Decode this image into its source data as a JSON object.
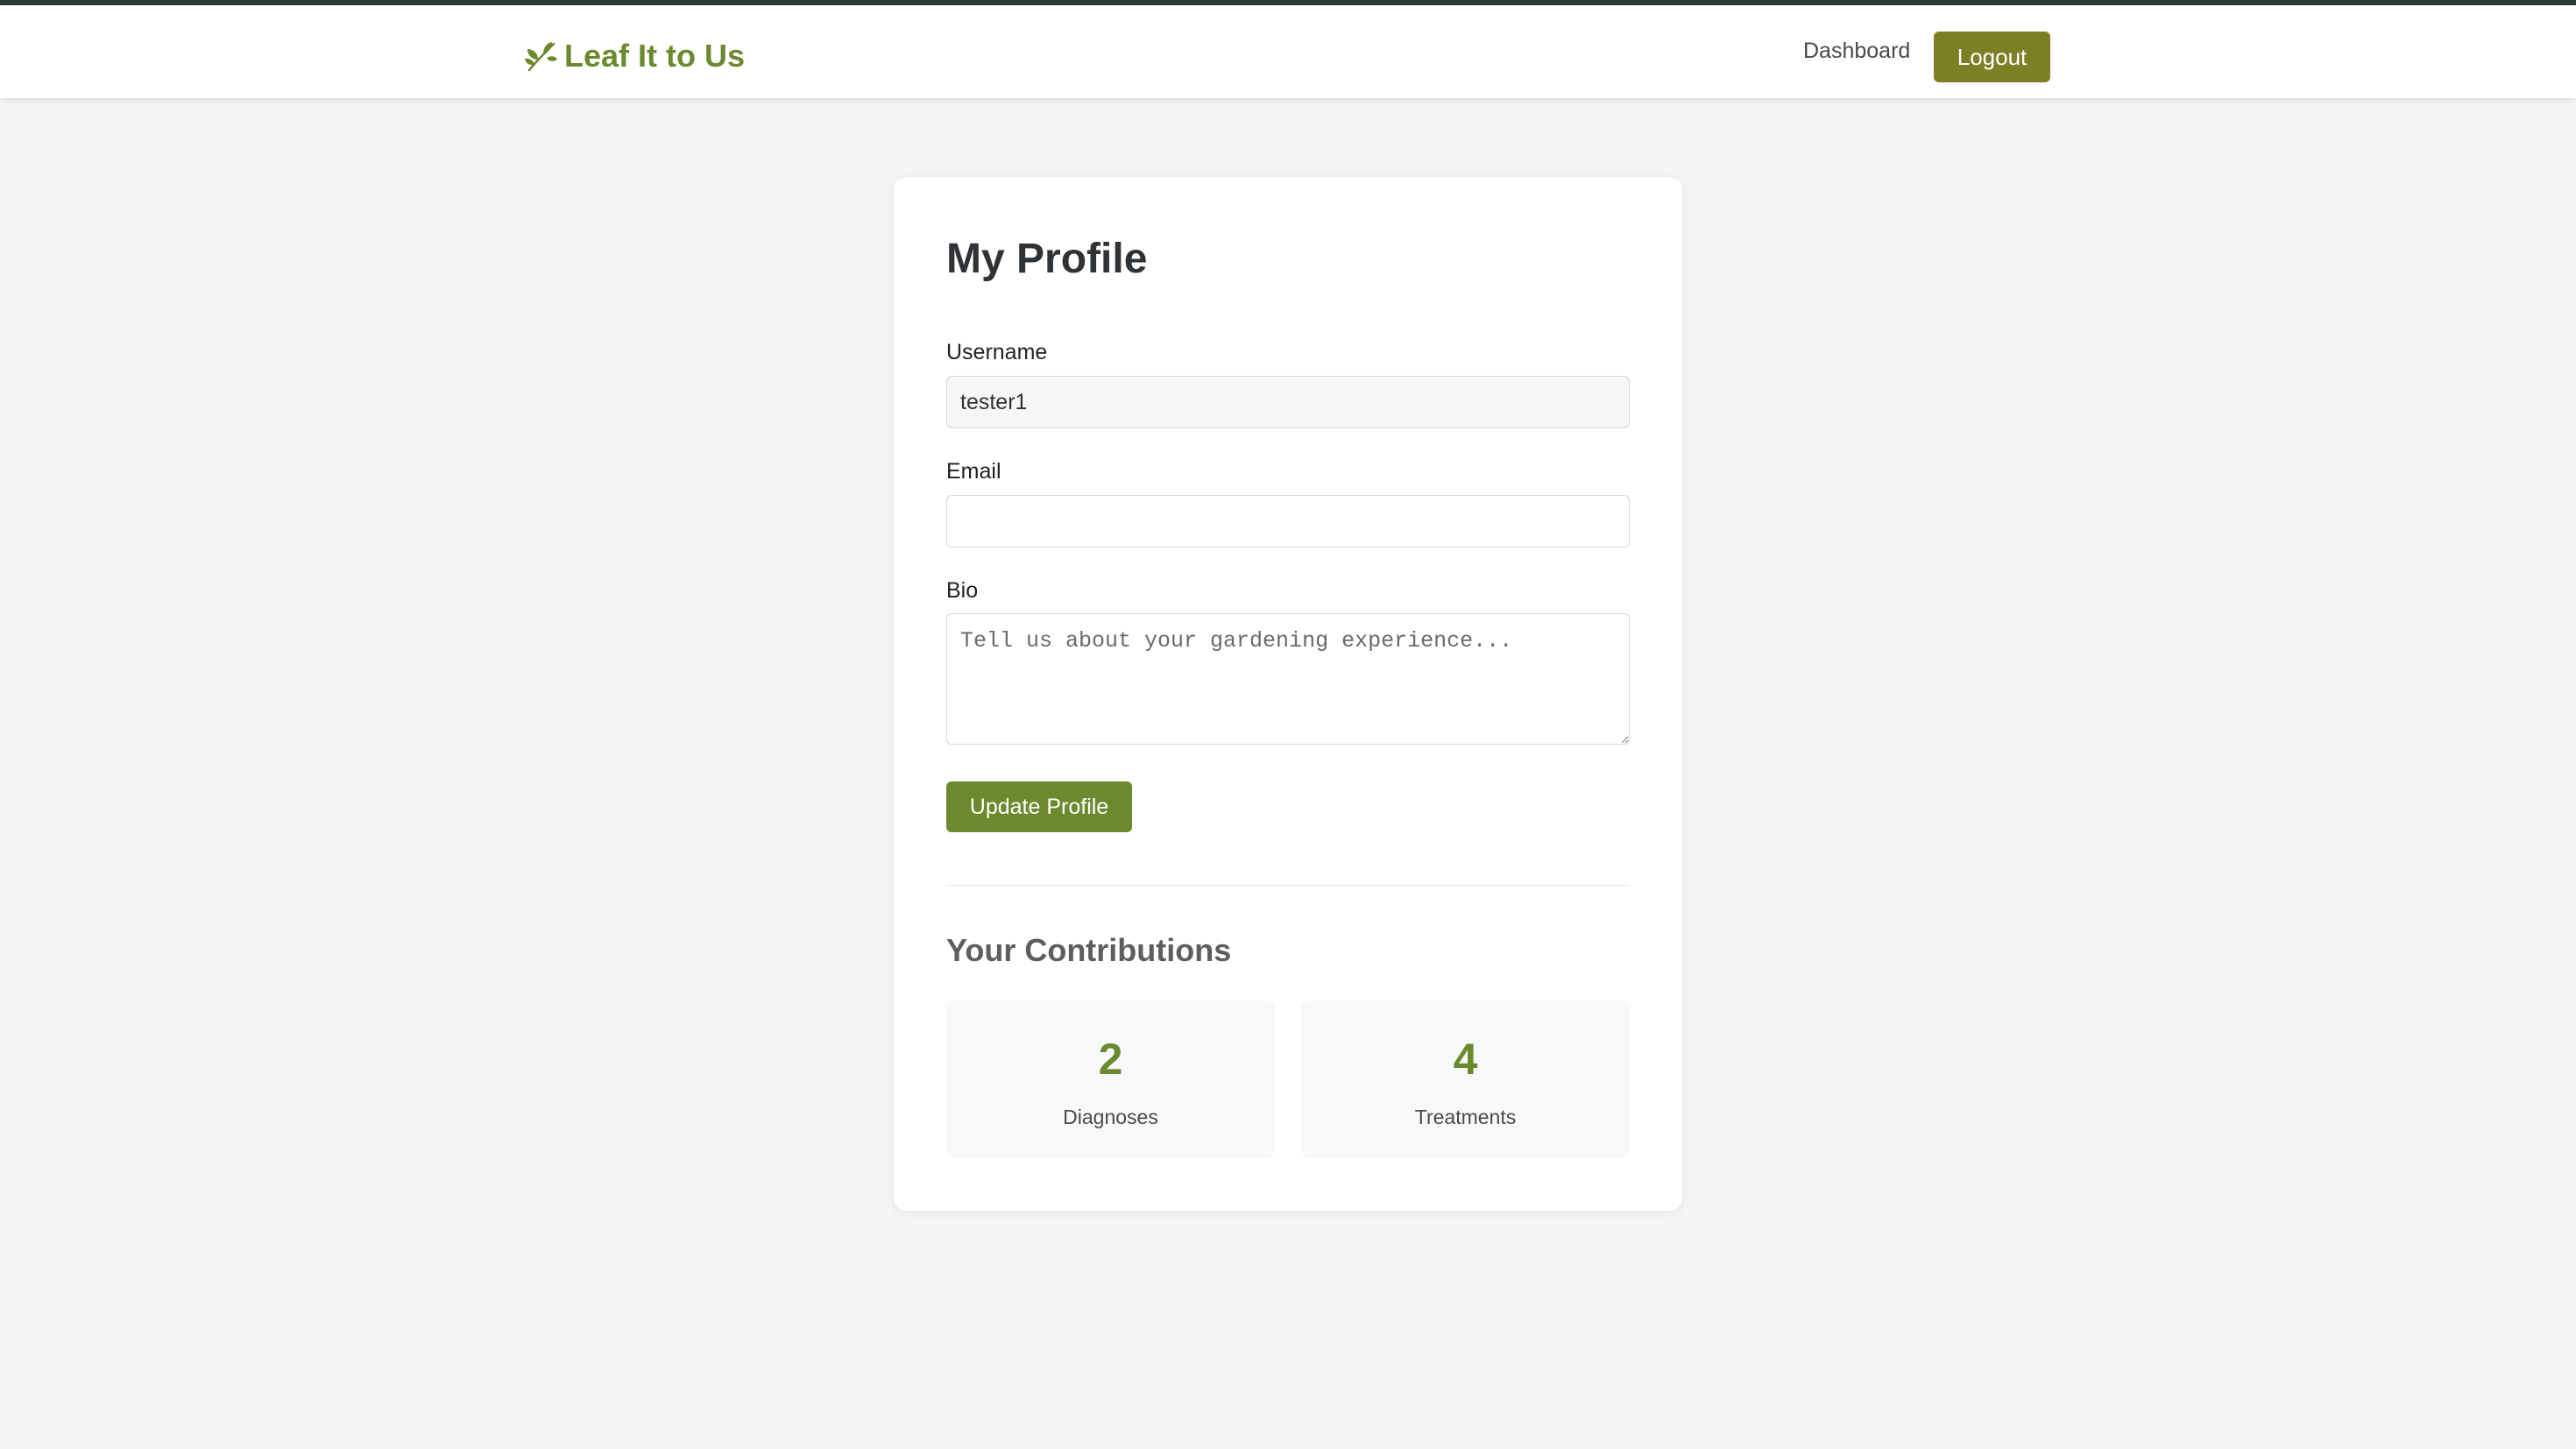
{
  "header": {
    "brand": "Leaf It to Us",
    "nav_dashboard": "Dashboard",
    "logout_label": "Logout"
  },
  "profile": {
    "title": "My Profile",
    "username_label": "Username",
    "username_value": "tester1",
    "email_label": "Email",
    "email_value": "",
    "bio_label": "Bio",
    "bio_placeholder": "Tell us about your gardening experience...",
    "update_label": "Update Profile"
  },
  "contributions": {
    "title": "Your Contributions",
    "stats": [
      {
        "value": "2",
        "label": "Diagnoses"
      },
      {
        "value": "4",
        "label": "Treatments"
      }
    ]
  },
  "icons": {
    "brand_icon": "leaf-icon"
  },
  "colors": {
    "brand_green": "#6b8a2e",
    "logout_olive": "#7d7f25",
    "header_top_border": "#2b3a32",
    "page_background": "#f4f4f4"
  }
}
